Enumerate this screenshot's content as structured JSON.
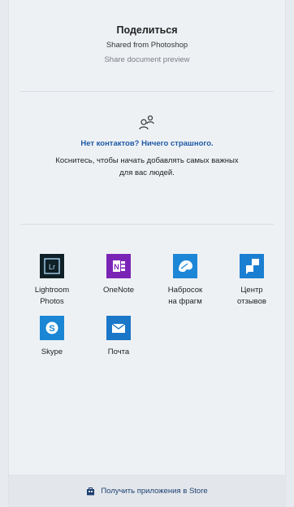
{
  "header": {
    "title": "Поделиться",
    "subtitle": "Shared from Photoshop",
    "preview_link": "Share document preview"
  },
  "contacts": {
    "icon": "contacts-icon",
    "link": "Нет контактов? Ничего страшного.",
    "hint_line1": "Коснитесь, чтобы начать добавлять самых важных",
    "hint_line2": "для вас людей."
  },
  "apps": [
    {
      "name": "Lightroom Photos",
      "line1": "Lightroom",
      "line2": "Photos",
      "color": "#0f2026",
      "icon": "lightroom-icon"
    },
    {
      "name": "OneNote",
      "line1": "OneNote",
      "line2": "",
      "color": "#7a24b6",
      "icon": "onenote-icon"
    },
    {
      "name": "Набросок на фрагменте",
      "line1": "Набросок",
      "line2": "на фрагм",
      "color": "#1e86d6",
      "icon": "snip-sketch-icon"
    },
    {
      "name": "Центр отзывов",
      "line1": "Центр",
      "line2": "отзывов",
      "color": "#1b7fd1",
      "icon": "feedback-hub-icon"
    },
    {
      "name": "Skype",
      "line1": "Skype",
      "line2": "",
      "color": "#1a86d4",
      "icon": "skype-icon"
    },
    {
      "name": "Почта",
      "line1": "Почта",
      "line2": "",
      "color": "#1b77c8",
      "icon": "mail-icon"
    }
  ],
  "footer": {
    "store_label": "Получить приложения в Store",
    "icon": "store-icon"
  }
}
